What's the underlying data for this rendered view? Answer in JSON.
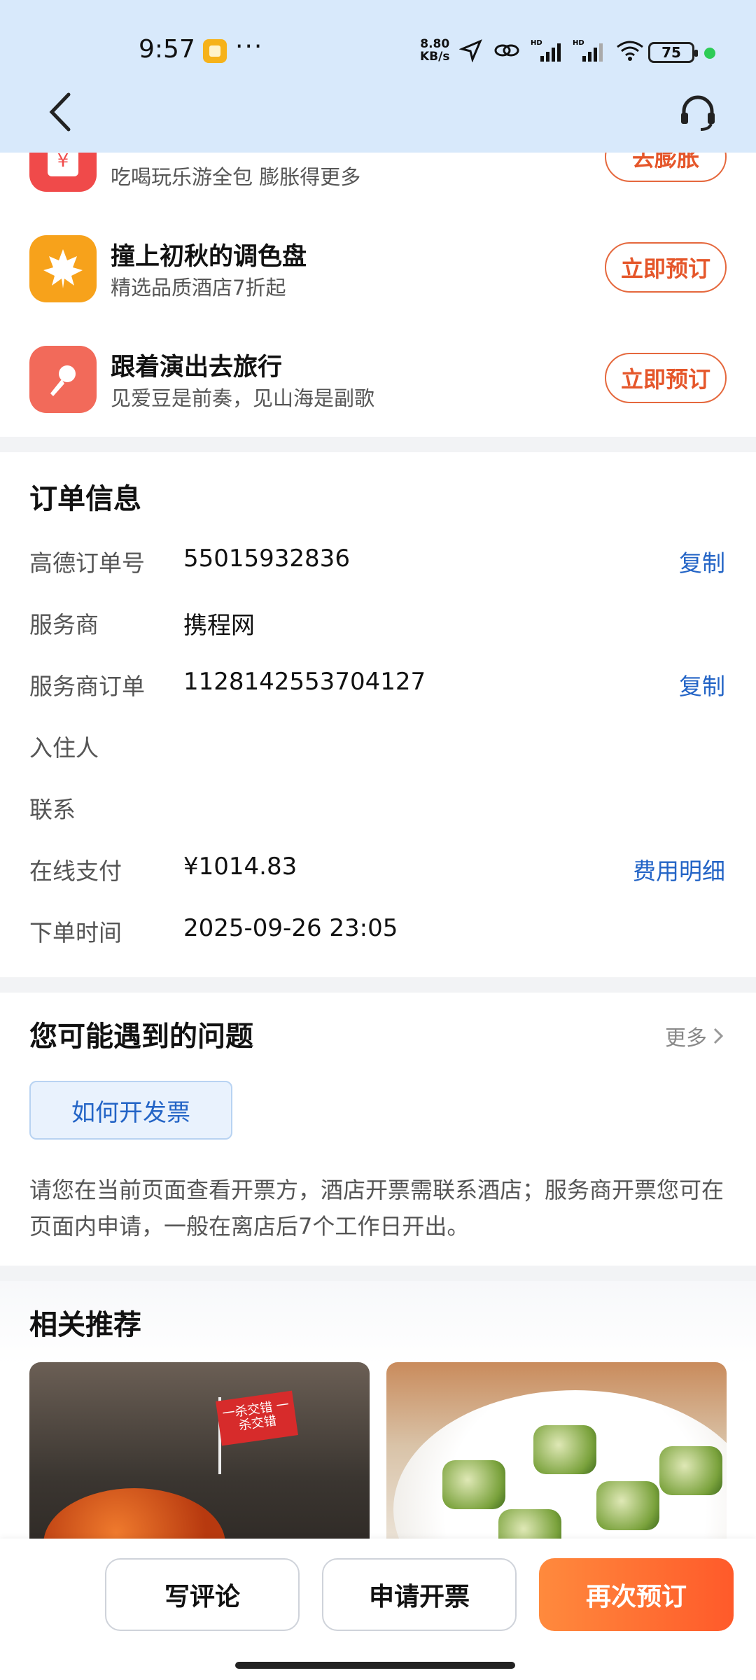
{
  "status_bar": {
    "time": "9:57",
    "more": "···",
    "net_speed_value": "8.80",
    "net_speed_unit": "KB/s",
    "battery": "75",
    "icons": [
      "location-arrow-icon",
      "link-icon",
      "hd-signal-icon",
      "hd-signal-icon",
      "wifi-icon"
    ]
  },
  "nav": {
    "back_icon": "chevron-left-icon",
    "service_icon": "headset-icon"
  },
  "promos": [
    {
      "icon": "red-envelope-icon",
      "icon_color": "#f04a4a",
      "title": "",
      "subtitle": "吃喝玩乐游全包 膨胀得更多",
      "button": "去膨胀"
    },
    {
      "icon": "maple-leaf-icon",
      "icon_color": "#f7a21b",
      "title": "撞上初秋的调色盘",
      "subtitle": "精选品质酒店7折起",
      "button": "立即预订"
    },
    {
      "icon": "microphone-icon",
      "icon_color": "#f26a5a",
      "title": "跟着演出去旅行",
      "subtitle": "见爱豆是前奏，见山海是副歌",
      "button": "立即预订"
    }
  ],
  "order_info": {
    "title": "订单信息",
    "rows": [
      {
        "label": "高德订单号",
        "value": "55015932836",
        "action": "复制"
      },
      {
        "label": "服务商",
        "value": "携程网",
        "action": ""
      },
      {
        "label": "服务商订单",
        "value": "1128142553704127",
        "action": "复制"
      },
      {
        "label": "入住人",
        "value": "",
        "action": ""
      },
      {
        "label": "联系",
        "value": "",
        "action": ""
      },
      {
        "label": "在线支付",
        "value": "¥1014.83",
        "action": "费用明细"
      },
      {
        "label": "下单时间",
        "value": "2025-09-26 23:05",
        "action": ""
      }
    ]
  },
  "faq": {
    "title": "您可能遇到的问题",
    "more": "更多",
    "question": "如何开发票",
    "answer": "请您在当前页面查看开票方，酒店开票需联系酒店；服务商开票您可在页面内申请，一般在离店后7个工作日开出。"
  },
  "recommend": {
    "title": "相关推荐",
    "left_flag_text": "一杀交错 一杀交错"
  },
  "bottom_bar": {
    "review": "写评论",
    "invoice": "申请开票",
    "rebook": "再次预订"
  },
  "colors": {
    "header_bg": "#d8e9fb",
    "link_blue": "#2364c6",
    "promo_orange": "#e5562a",
    "primary_gradient_start": "#ff8a3d",
    "primary_gradient_end": "#ff5a2a"
  }
}
